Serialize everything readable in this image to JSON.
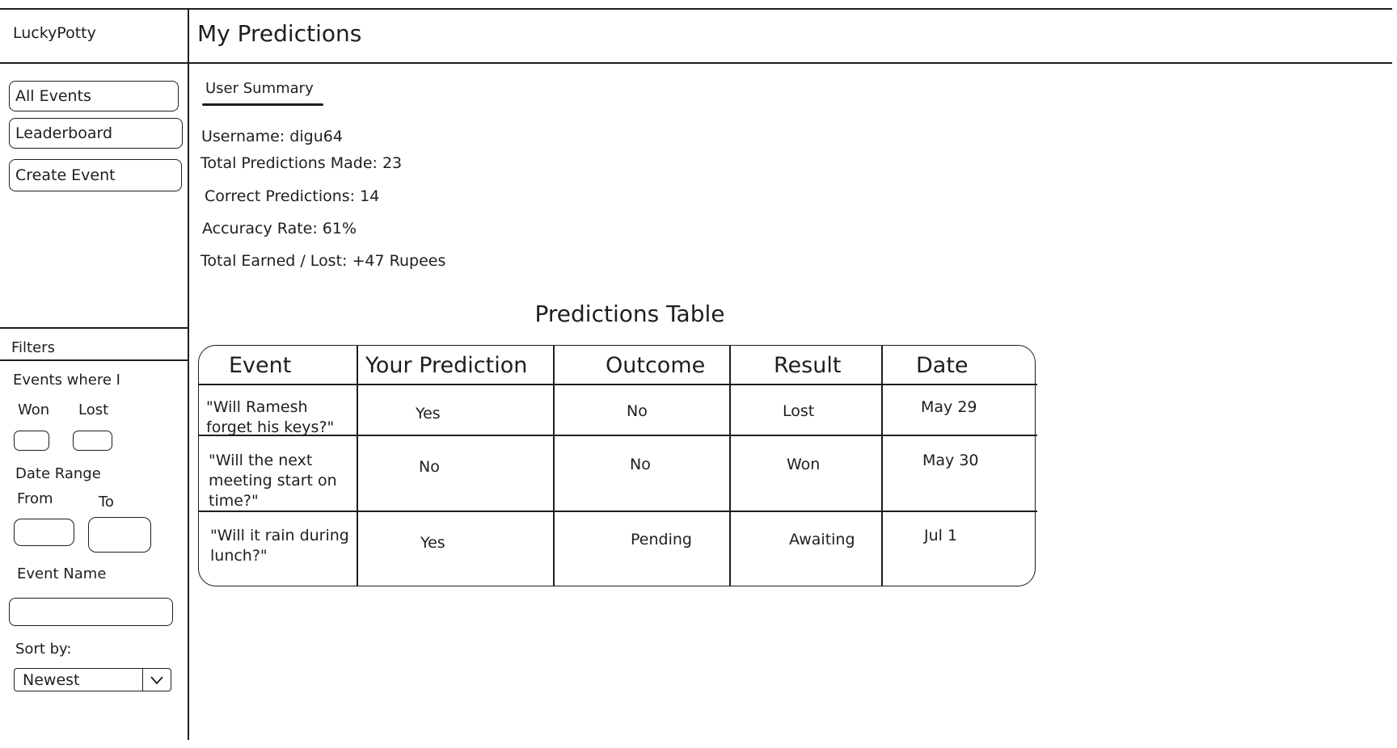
{
  "app": {
    "logo": "LuckyPotty",
    "page_title": "My Predictions"
  },
  "nav": [
    {
      "label": "All Events"
    },
    {
      "label": "Leaderboard"
    },
    {
      "label": "Create Event"
    }
  ],
  "filters": {
    "title": "Filters",
    "events_where": "Events where I",
    "won_label": "Won",
    "lost_label": "Lost",
    "date_range": "Date Range",
    "from_label": "From",
    "to_label": "To",
    "event_name_label": "Event Name",
    "event_name_value": "",
    "sort_label": "Sort by:",
    "sort_value": "Newest"
  },
  "summary": {
    "tab": "User Summary",
    "username": "Username: digu64",
    "total_predictions": "Total Predictions Made: 23",
    "correct_predictions": "Correct Predictions: 14",
    "accuracy": "Accuracy Rate: 61%",
    "earned_lost": "Total Earned / Lost: +47 Rupees"
  },
  "table": {
    "title": "Predictions Table",
    "headers": [
      "Event",
      "Your Prediction",
      "Outcome",
      "Result",
      "Date"
    ],
    "rows": [
      {
        "event_l1": "\"Will Ramesh",
        "event_l2": "forget his keys?\"",
        "event_l3": "",
        "prediction": "Yes",
        "outcome": "No",
        "result": "Lost",
        "date": "May 29"
      },
      {
        "event_l1": "\"Will the next",
        "event_l2": "meeting start on",
        "event_l3": "time?\"",
        "prediction": "No",
        "outcome": "No",
        "result": "Won",
        "date": "May 30"
      },
      {
        "event_l1": "\"Will it rain during",
        "event_l2": "lunch?\"",
        "event_l3": "",
        "prediction": "Yes",
        "outcome": "Pending",
        "result": "Awaiting",
        "date": "Jul 1"
      }
    ]
  },
  "icons": {
    "dropdown": "chevron-down-icon"
  }
}
